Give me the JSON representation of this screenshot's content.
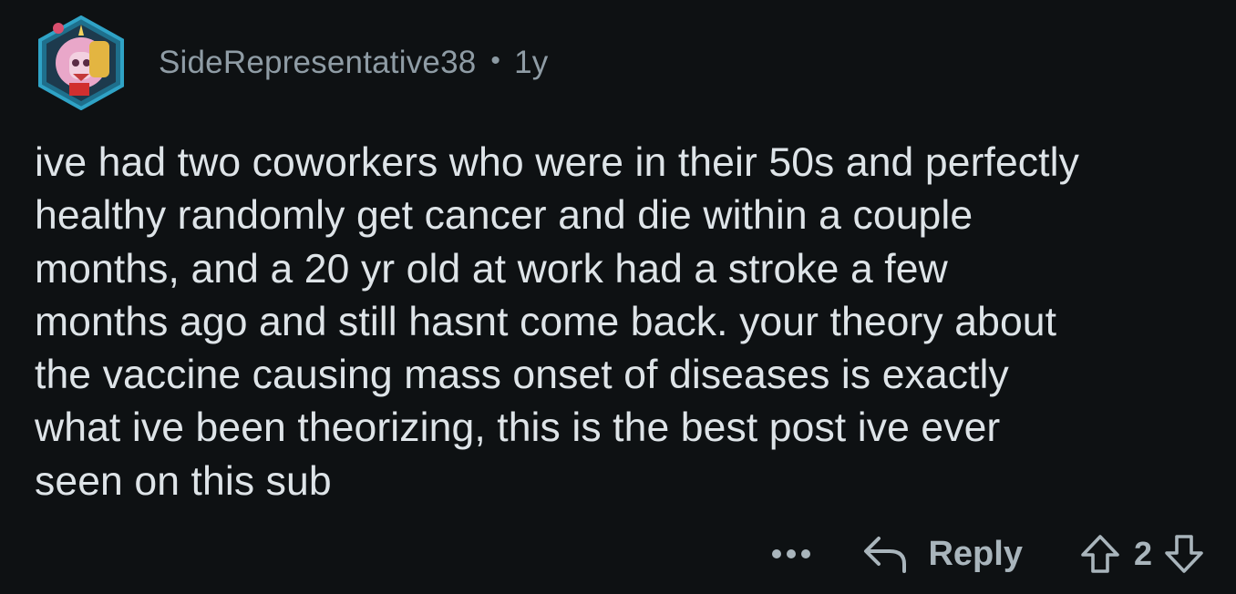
{
  "comment": {
    "author": "SideRepresentative38",
    "separator": "•",
    "age": "1y",
    "body_lines": [
      "ive had two coworkers who were in their 50s and perfectly",
      "healthy randomly get cancer and die within a couple",
      "months, and a 20 yr old at work had a stroke a few",
      "months ago and still hasnt come back. your theory about",
      "the vaccine causing mass onset of diseases is exactly",
      "what ive been theorizing, this is the best post ive ever",
      "seen on this sub"
    ],
    "avatar_icon": "user-avatar-icon"
  },
  "actions": {
    "more_icon": "ellipsis-icon",
    "reply_icon": "reply-arrow-icon",
    "reply_label": "Reply",
    "upvote_icon": "upvote-arrow-icon",
    "downvote_icon": "downvote-arrow-icon",
    "vote_count": "2"
  },
  "colors": {
    "background": "#0e1113",
    "body_text": "#dee4e8",
    "meta_text": "#8f9ca5",
    "action_text": "#a9b5bc"
  }
}
